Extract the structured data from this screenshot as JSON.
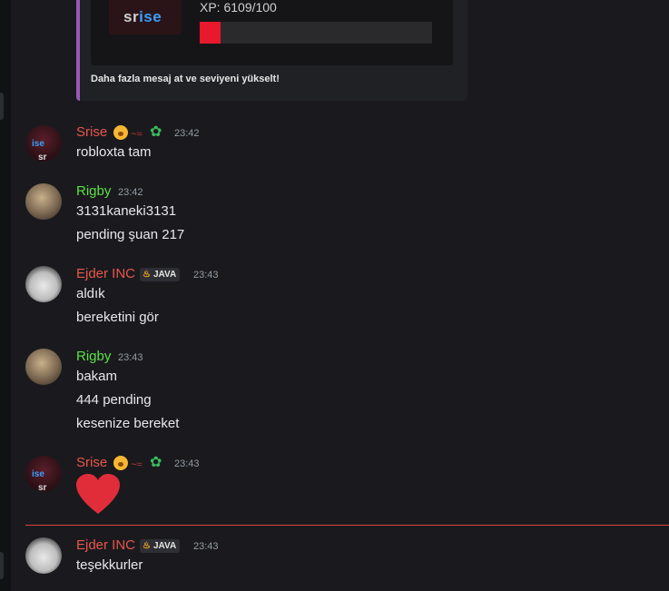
{
  "embed": {
    "logo_text_a": "sr",
    "logo_text_b": "ise",
    "xp_text": "XP: 6109/100",
    "xp_fraction": 0.09,
    "footer": "Daha fazla mesaj at ve seviyeni yükselt!",
    "accent_color": "#9b59b6"
  },
  "messages": [
    {
      "author": "Srise",
      "time": "23:42",
      "lines": [
        "robloxta tam"
      ]
    },
    {
      "author": "Rigby",
      "time": "23:42",
      "lines": [
        "3131kaneki3131",
        "pending şuan 217"
      ]
    },
    {
      "author": "Ejder INC",
      "tag": "JAVA",
      "time": "23:43",
      "lines": [
        "aldık",
        "bereketini gör"
      ]
    },
    {
      "author": "Rigby",
      "time": "23:43",
      "lines": [
        "bakam",
        "444 pending",
        "kesenize bereket"
      ]
    },
    {
      "author": "Srise",
      "time": "23:43",
      "lines": []
    },
    {
      "author": "Ejder INC",
      "tag": "JAVA",
      "time": "23:43",
      "lines": [
        "teşekkurler"
      ]
    }
  ],
  "avatars": {
    "srise_text_a": "sr",
    "srise_text_b": "ise"
  },
  "icons": {
    "face": "nerd-face-emoji",
    "signature": "signature-emoji",
    "clover": "clover-emoji",
    "flame": "flame-icon",
    "heart": "heart-emoji"
  },
  "colors": {
    "srise": "#e8564a",
    "rigby": "#5be046",
    "ejder": "#e8564a",
    "new_divider": "#d9413b"
  }
}
